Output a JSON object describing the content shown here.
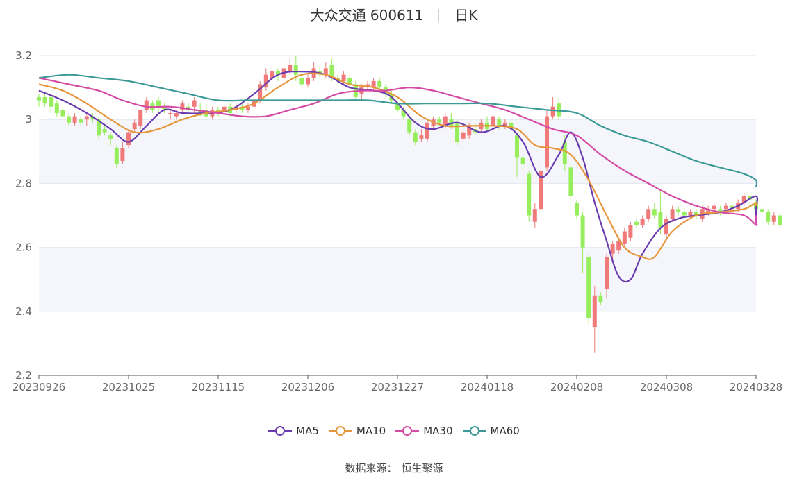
{
  "header": {
    "name": "大众交通 600611",
    "period": "日K"
  },
  "source": {
    "label": "数据来源：",
    "value": "恒生聚源"
  },
  "colors": {
    "up": "#f07a7a",
    "down": "#96ee5d",
    "ma5": "#6a3bb1",
    "ma10": "#e6963c",
    "ma30": "#d44aa5",
    "ma60": "#3b9a97",
    "grid": "#e2e6f0",
    "band": "#f5f6fb"
  },
  "chart_data": {
    "type": "candlestick",
    "title": "大众交通 600611 日K",
    "ylim": [
      2.2,
      3.2
    ],
    "yticks": [
      "2.2",
      "2.4",
      "2.6",
      "2.8",
      "3",
      "3.2"
    ],
    "xticks": [
      "20230926",
      "20231025",
      "20231115",
      "20231206",
      "20231227",
      "20240118",
      "20240208",
      "20240308",
      "20240328"
    ],
    "num_days": 121,
    "legend": [
      "MA5",
      "MA10",
      "MA30",
      "MA60"
    ],
    "candles": [
      [
        3.07,
        3.06,
        3.04,
        3.08
      ],
      [
        3.07,
        3.05,
        3.04,
        3.08
      ],
      [
        3.07,
        3.04,
        3.02,
        3.08
      ],
      [
        3.05,
        3.02,
        3.01,
        3.06
      ],
      [
        3.03,
        3.01,
        3.0,
        3.04
      ],
      [
        3.01,
        2.99,
        2.98,
        3.02
      ],
      [
        2.99,
        3.01,
        2.98,
        3.02
      ],
      [
        3.0,
        2.99,
        2.98,
        3.01
      ],
      [
        3.0,
        3.01,
        2.98,
        3.02
      ],
      [
        3.01,
        3.0,
        2.99,
        3.02
      ],
      [
        3.0,
        2.95,
        2.94,
        3.01
      ],
      [
        2.97,
        2.96,
        2.95,
        2.98
      ],
      [
        2.95,
        2.94,
        2.92,
        2.96
      ],
      [
        2.91,
        2.86,
        2.85,
        2.92
      ],
      [
        2.87,
        2.91,
        2.86,
        2.93
      ],
      [
        2.92,
        2.96,
        2.91,
        2.97
      ],
      [
        2.97,
        2.99,
        2.96,
        3.0
      ],
      [
        2.98,
        3.03,
        2.97,
        3.03
      ],
      [
        3.03,
        3.06,
        3.02,
        3.07
      ],
      [
        3.05,
        3.03,
        3.02,
        3.06
      ],
      [
        3.06,
        3.04,
        3.02,
        3.07
      ],
      [
        3.04,
        3.03,
        3.02,
        3.05
      ],
      [
        3.02,
        3.02,
        3.0,
        3.03
      ],
      [
        3.01,
        3.02,
        3.0,
        3.03
      ],
      [
        3.03,
        3.05,
        3.02,
        3.06
      ],
      [
        3.04,
        3.03,
        3.02,
        3.05
      ],
      [
        3.04,
        3.06,
        3.02,
        3.07
      ],
      [
        3.03,
        3.02,
        3.01,
        3.05
      ],
      [
        3.03,
        3.01,
        3.0,
        3.05
      ],
      [
        3.01,
        3.03,
        3.0,
        3.04
      ],
      [
        3.03,
        3.02,
        3.01,
        3.04
      ],
      [
        3.03,
        3.04,
        3.02,
        3.05
      ],
      [
        3.04,
        3.02,
        3.01,
        3.05
      ],
      [
        3.03,
        3.04,
        3.02,
        3.05
      ],
      [
        3.04,
        3.03,
        3.02,
        3.05
      ],
      [
        3.03,
        3.04,
        3.02,
        3.05
      ],
      [
        3.04,
        3.06,
        3.03,
        3.07
      ],
      [
        3.06,
        3.11,
        3.05,
        3.12
      ],
      [
        3.1,
        3.14,
        3.09,
        3.16
      ],
      [
        3.13,
        3.15,
        3.12,
        3.17
      ],
      [
        3.15,
        3.14,
        3.12,
        3.16
      ],
      [
        3.13,
        3.16,
        3.12,
        3.18
      ],
      [
        3.15,
        3.17,
        3.14,
        3.19
      ],
      [
        3.17,
        3.14,
        3.12,
        3.2
      ],
      [
        3.13,
        3.11,
        3.1,
        3.14
      ],
      [
        3.11,
        3.13,
        3.1,
        3.14
      ],
      [
        3.13,
        3.16,
        3.12,
        3.18
      ],
      [
        3.15,
        3.14,
        3.13,
        3.17
      ],
      [
        3.14,
        3.16,
        3.13,
        3.18
      ],
      [
        3.17,
        3.13,
        3.12,
        3.19
      ],
      [
        3.13,
        3.12,
        3.11,
        3.14
      ],
      [
        3.12,
        3.14,
        3.11,
        3.15
      ],
      [
        3.13,
        3.11,
        3.1,
        3.14
      ],
      [
        3.11,
        3.07,
        3.06,
        3.12
      ],
      [
        3.08,
        3.1,
        3.06,
        3.11
      ],
      [
        3.1,
        3.11,
        3.09,
        3.12
      ],
      [
        3.1,
        3.12,
        3.09,
        3.13
      ],
      [
        3.12,
        3.1,
        3.09,
        3.13
      ],
      [
        3.1,
        3.08,
        3.07,
        3.11
      ],
      [
        3.08,
        3.06,
        3.05,
        3.09
      ],
      [
        3.05,
        3.03,
        3.02,
        3.06
      ],
      [
        3.03,
        3.01,
        3.0,
        3.04
      ],
      [
        3.0,
        2.96,
        2.95,
        3.01
      ],
      [
        2.96,
        2.93,
        2.92,
        2.97
      ],
      [
        2.94,
        2.95,
        2.93,
        2.97
      ],
      [
        2.94,
        2.99,
        2.93,
        3.0
      ],
      [
        2.98,
        3.0,
        2.97,
        3.01
      ],
      [
        3.0,
        2.99,
        2.98,
        3.01
      ],
      [
        2.98,
        3.01,
        2.97,
        3.02
      ],
      [
        3.0,
        2.98,
        2.97,
        3.02
      ],
      [
        2.99,
        2.93,
        2.92,
        3.0
      ],
      [
        2.94,
        2.96,
        2.93,
        2.97
      ],
      [
        2.95,
        2.98,
        2.94,
        2.99
      ],
      [
        2.97,
        2.96,
        2.95,
        2.99
      ],
      [
        2.97,
        2.99,
        2.96,
        3.0
      ],
      [
        2.99,
        2.97,
        2.96,
        3.01
      ],
      [
        2.98,
        3.01,
        2.97,
        3.02
      ],
      [
        3.0,
        2.98,
        2.97,
        3.01
      ],
      [
        2.98,
        2.99,
        2.97,
        3.0
      ],
      [
        2.99,
        2.97,
        2.96,
        3.0
      ],
      [
        2.95,
        2.88,
        2.82,
        2.96
      ],
      [
        2.88,
        2.86,
        2.84,
        2.89
      ],
      [
        2.83,
        2.7,
        2.68,
        2.84
      ],
      [
        2.68,
        2.72,
        2.66,
        2.74
      ],
      [
        2.72,
        2.84,
        2.71,
        2.86
      ],
      [
        2.85,
        3.01,
        2.84,
        3.03
      ],
      [
        3.01,
        3.04,
        3.0,
        3.07
      ],
      [
        3.05,
        3.01,
        3.0,
        3.07
      ],
      [
        2.93,
        2.86,
        2.84,
        2.95
      ],
      [
        2.85,
        2.76,
        2.74,
        2.86
      ],
      [
        2.74,
        2.7,
        2.69,
        2.75
      ],
      [
        2.7,
        2.6,
        2.52,
        2.71
      ],
      [
        2.57,
        2.38,
        2.36,
        2.58
      ],
      [
        2.35,
        2.45,
        2.27,
        2.48
      ],
      [
        2.45,
        2.43,
        2.42,
        2.46
      ],
      [
        2.47,
        2.57,
        2.44,
        2.58
      ],
      [
        2.58,
        2.61,
        2.56,
        2.62
      ],
      [
        2.59,
        2.62,
        2.58,
        2.63
      ],
      [
        2.61,
        2.65,
        2.6,
        2.66
      ],
      [
        2.63,
        2.67,
        2.62,
        2.68
      ],
      [
        2.68,
        2.67,
        2.66,
        2.69
      ],
      [
        2.67,
        2.69,
        2.66,
        2.7
      ],
      [
        2.69,
        2.72,
        2.68,
        2.73
      ],
      [
        2.72,
        2.7,
        2.69,
        2.74
      ],
      [
        2.71,
        2.66,
        2.64,
        2.78
      ],
      [
        2.64,
        2.69,
        2.63,
        2.7
      ],
      [
        2.69,
        2.72,
        2.68,
        2.73
      ],
      [
        2.72,
        2.71,
        2.7,
        2.73
      ],
      [
        2.71,
        2.7,
        2.69,
        2.72
      ],
      [
        2.7,
        2.71,
        2.69,
        2.72
      ],
      [
        2.71,
        2.7,
        2.69,
        2.72
      ],
      [
        2.69,
        2.72,
        2.68,
        2.73
      ],
      [
        2.71,
        2.72,
        2.7,
        2.73
      ],
      [
        2.72,
        2.73,
        2.71,
        2.74
      ],
      [
        2.72,
        2.71,
        2.7,
        2.73
      ],
      [
        2.72,
        2.73,
        2.71,
        2.74
      ],
      [
        2.73,
        2.72,
        2.71,
        2.74
      ],
      [
        2.72,
        2.74,
        2.71,
        2.75
      ],
      [
        2.74,
        2.76,
        2.73,
        2.77
      ],
      [
        2.76,
        2.75,
        2.73,
        2.77
      ],
      [
        2.74,
        2.72,
        2.71,
        2.75
      ],
      [
        2.72,
        2.71,
        2.7,
        2.73
      ],
      [
        2.71,
        2.68,
        2.67,
        2.72
      ],
      [
        2.68,
        2.7,
        2.67,
        2.71
      ],
      [
        2.7,
        2.67,
        2.66,
        2.71
      ]
    ],
    "series": [
      {
        "name": "MA5",
        "points": [
          [
            0,
            3.09
          ],
          [
            4,
            3.06
          ],
          [
            8,
            3.02
          ],
          [
            12,
            2.97
          ],
          [
            15,
            2.93
          ],
          [
            18,
            2.98
          ],
          [
            21,
            3.03
          ],
          [
            24,
            3.02
          ],
          [
            28,
            3.02
          ],
          [
            32,
            3.03
          ],
          [
            36,
            3.08
          ],
          [
            40,
            3.14
          ],
          [
            44,
            3.15
          ],
          [
            48,
            3.14
          ],
          [
            52,
            3.1
          ],
          [
            56,
            3.09
          ],
          [
            59,
            3.07
          ],
          [
            63,
            2.99
          ],
          [
            66,
            2.97
          ],
          [
            70,
            2.99
          ],
          [
            74,
            2.96
          ],
          [
            78,
            2.98
          ],
          [
            81,
            2.93
          ],
          [
            84,
            2.82
          ],
          [
            87,
            2.89
          ],
          [
            89,
            2.96
          ],
          [
            91,
            2.88
          ],
          [
            93,
            2.74
          ],
          [
            95,
            2.62
          ],
          [
            97,
            2.51
          ],
          [
            99,
            2.5
          ],
          [
            101,
            2.58
          ],
          [
            104,
            2.66
          ],
          [
            107,
            2.69
          ],
          [
            110,
            2.7
          ],
          [
            114,
            2.71
          ],
          [
            117,
            2.73
          ],
          [
            120,
            2.76
          ],
          [
            122,
            2.72
          ],
          [
            125,
            2.7
          ]
        ]
      },
      {
        "name": "MA10",
        "points": [
          [
            0,
            3.11
          ],
          [
            4,
            3.09
          ],
          [
            8,
            3.05
          ],
          [
            12,
            3.0
          ],
          [
            16,
            2.96
          ],
          [
            20,
            2.97
          ],
          [
            24,
            3.0
          ],
          [
            28,
            3.02
          ],
          [
            32,
            3.03
          ],
          [
            36,
            3.05
          ],
          [
            40,
            3.1
          ],
          [
            44,
            3.14
          ],
          [
            48,
            3.14
          ],
          [
            52,
            3.11
          ],
          [
            56,
            3.1
          ],
          [
            60,
            3.07
          ],
          [
            64,
            3.01
          ],
          [
            68,
            2.98
          ],
          [
            72,
            2.98
          ],
          [
            76,
            2.98
          ],
          [
            80,
            2.97
          ],
          [
            83,
            2.92
          ],
          [
            86,
            2.91
          ],
          [
            89,
            2.89
          ],
          [
            92,
            2.81
          ],
          [
            95,
            2.7
          ],
          [
            98,
            2.6
          ],
          [
            101,
            2.57
          ],
          [
            103,
            2.57
          ],
          [
            106,
            2.65
          ],
          [
            110,
            2.7
          ],
          [
            114,
            2.71
          ],
          [
            118,
            2.72
          ],
          [
            122,
            2.74
          ],
          [
            125,
            2.73
          ]
        ]
      },
      {
        "name": "MA30",
        "points": [
          [
            0,
            3.13
          ],
          [
            5,
            3.11
          ],
          [
            10,
            3.09
          ],
          [
            14,
            3.06
          ],
          [
            18,
            3.04
          ],
          [
            22,
            3.04
          ],
          [
            26,
            3.03
          ],
          [
            30,
            3.02
          ],
          [
            34,
            3.01
          ],
          [
            38,
            3.01
          ],
          [
            42,
            3.03
          ],
          [
            46,
            3.05
          ],
          [
            50,
            3.08
          ],
          [
            54,
            3.09
          ],
          [
            58,
            3.09
          ],
          [
            62,
            3.1
          ],
          [
            66,
            3.09
          ],
          [
            70,
            3.07
          ],
          [
            74,
            3.05
          ],
          [
            78,
            3.03
          ],
          [
            82,
            3.0
          ],
          [
            86,
            2.97
          ],
          [
            90,
            2.95
          ],
          [
            94,
            2.89
          ],
          [
            98,
            2.84
          ],
          [
            102,
            2.8
          ],
          [
            106,
            2.76
          ],
          [
            110,
            2.73
          ],
          [
            114,
            2.71
          ],
          [
            118,
            2.7
          ],
          [
            121,
            2.67
          ],
          [
            124,
            2.68
          ],
          [
            126,
            2.7
          ]
        ]
      },
      {
        "name": "MA60",
        "points": [
          [
            0,
            3.13
          ],
          [
            5,
            3.14
          ],
          [
            10,
            3.13
          ],
          [
            15,
            3.12
          ],
          [
            20,
            3.1
          ],
          [
            25,
            3.08
          ],
          [
            30,
            3.06
          ],
          [
            35,
            3.06
          ],
          [
            40,
            3.06
          ],
          [
            45,
            3.06
          ],
          [
            50,
            3.06
          ],
          [
            55,
            3.06
          ],
          [
            60,
            3.05
          ],
          [
            65,
            3.05
          ],
          [
            70,
            3.05
          ],
          [
            75,
            3.05
          ],
          [
            80,
            3.04
          ],
          [
            85,
            3.03
          ],
          [
            90,
            3.02
          ],
          [
            94,
            2.98
          ],
          [
            98,
            2.95
          ],
          [
            102,
            2.93
          ],
          [
            106,
            2.9
          ],
          [
            110,
            2.87
          ],
          [
            114,
            2.85
          ],
          [
            118,
            2.83
          ],
          [
            122,
            2.81
          ],
          [
            126,
            2.79
          ]
        ]
      }
    ]
  }
}
